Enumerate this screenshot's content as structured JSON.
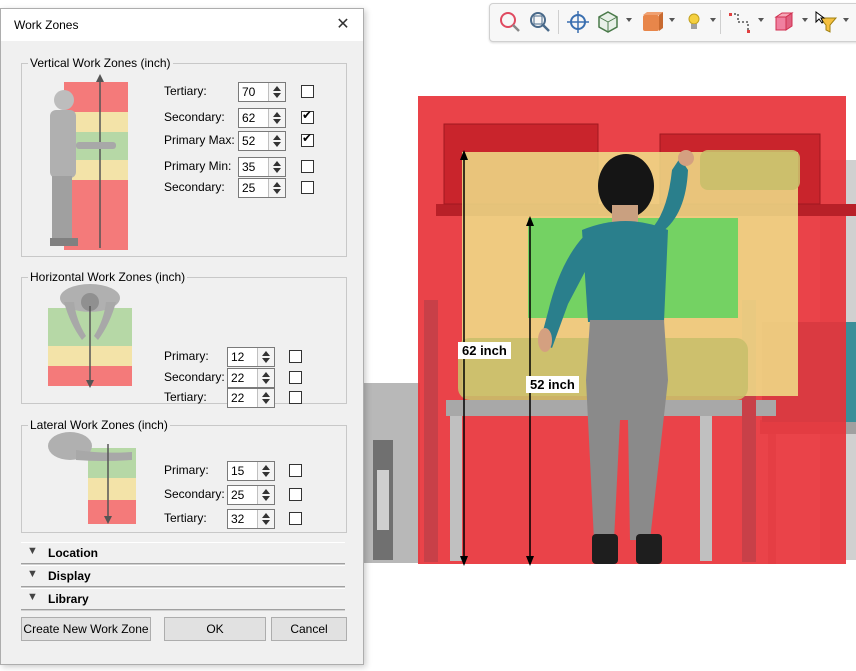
{
  "dialog": {
    "title": "Work Zones",
    "vertical": {
      "title": "Vertical Work Zones (inch)",
      "rows": [
        {
          "label": "Tertiary:",
          "value": "70",
          "checked": false
        },
        {
          "label": "Secondary:",
          "value": "62",
          "checked": true
        },
        {
          "label": "Primary Max:",
          "value": "52",
          "checked": true
        },
        {
          "label": "Primary Min:",
          "value": "35",
          "checked": false
        },
        {
          "label": "Secondary:",
          "value": "25",
          "checked": false
        }
      ]
    },
    "horizontal": {
      "title": "Horizontal Work Zones (inch)",
      "rows": [
        {
          "label": "Primary:",
          "value": "12",
          "checked": false
        },
        {
          "label": "Secondary:",
          "value": "22",
          "checked": false
        },
        {
          "label": "Tertiary:",
          "value": "22",
          "checked": false
        }
      ]
    },
    "lateral": {
      "title": "Lateral Work Zones (inch)",
      "rows": [
        {
          "label": "Primary:",
          "value": "15",
          "checked": false
        },
        {
          "label": "Secondary:",
          "value": "25",
          "checked": false
        },
        {
          "label": "Tertiary:",
          "value": "32",
          "checked": false
        }
      ]
    },
    "sections": [
      "Location",
      "Display",
      "Library"
    ],
    "buttons": {
      "create": "Create New Work Zone",
      "ok": "OK",
      "cancel": "Cancel"
    }
  },
  "viewport": {
    "label_62": "62 inch",
    "label_52": "52 inch"
  },
  "colors": {
    "zone_red": "#e8333a",
    "zone_yellow": "#f0e88c",
    "zone_green": "#5ed45e",
    "figure_shirt": "#2a7f8c"
  },
  "icons": [
    "zoom-icon",
    "zoom-window-icon",
    "target-icon",
    "view-cube-icon",
    "render-box-icon",
    "light-bulb-icon",
    "measure-icon",
    "section-box-icon",
    "filter-icon"
  ]
}
